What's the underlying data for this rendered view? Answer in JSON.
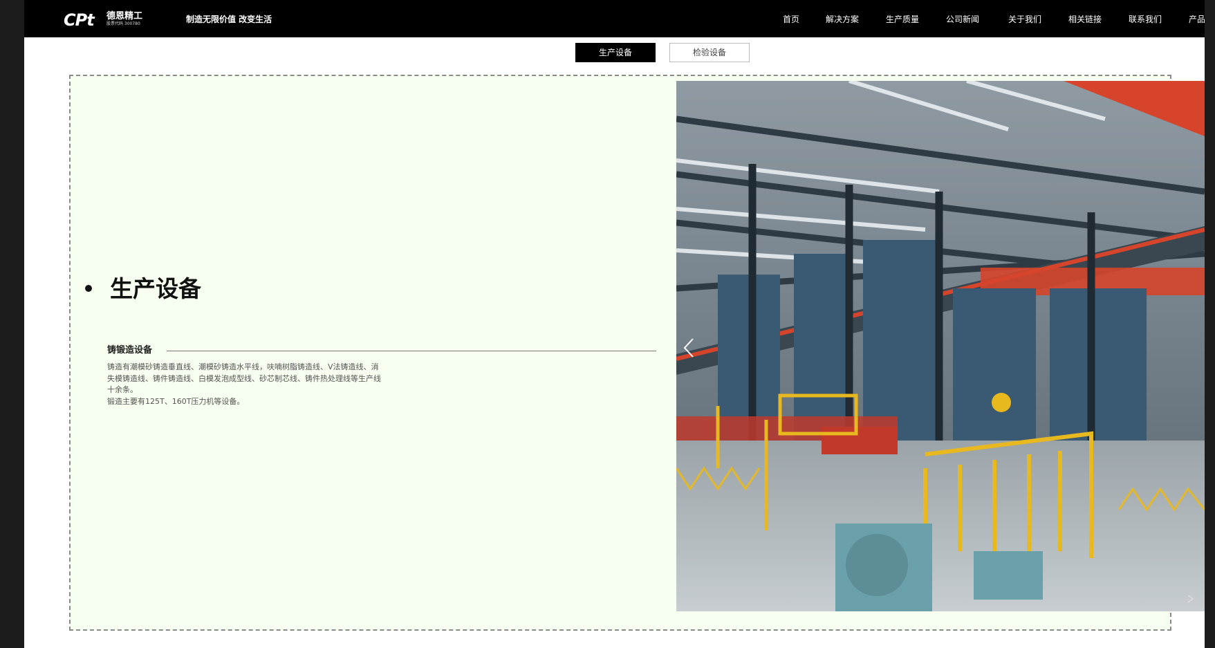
{
  "header": {
    "logo_mark": "CPt",
    "logo_cn": "德恩精工",
    "logo_sub": "股票代码 300780",
    "slogan": "制造无限价值 改变生活",
    "nav": [
      "首页",
      "解决方案",
      "生产质量",
      "公司新闻",
      "关于我们",
      "相关链接",
      "联系我们",
      "产品"
    ]
  },
  "tabs": [
    {
      "label": "生产设备",
      "active": true
    },
    {
      "label": "检验设备",
      "active": false
    }
  ],
  "section": {
    "title": "生产设备",
    "subtitle": "铸锻造设备",
    "description": [
      "铸造有潮模砂铸造垂直线、潮模砂铸造水平线，呋喃树脂铸造线、V法铸造线、消失模铸造线、铸件铸造线、白模发泡成型线、砂芯制芯线、铸件热处理线等生产线十余条。",
      "锻造主要有125T、160T压力机等设备。"
    ]
  },
  "photo": {
    "subject": "factory-interior-photo",
    "colors": {
      "steel": "#2e3a44",
      "red": "#d6452b",
      "yellow": "#e8b81f",
      "floor": "#b9c0c3",
      "teal": "#6aa0aa"
    }
  },
  "icons": {
    "prev": "chevron-left-icon",
    "next": "chevron-right-icon"
  }
}
